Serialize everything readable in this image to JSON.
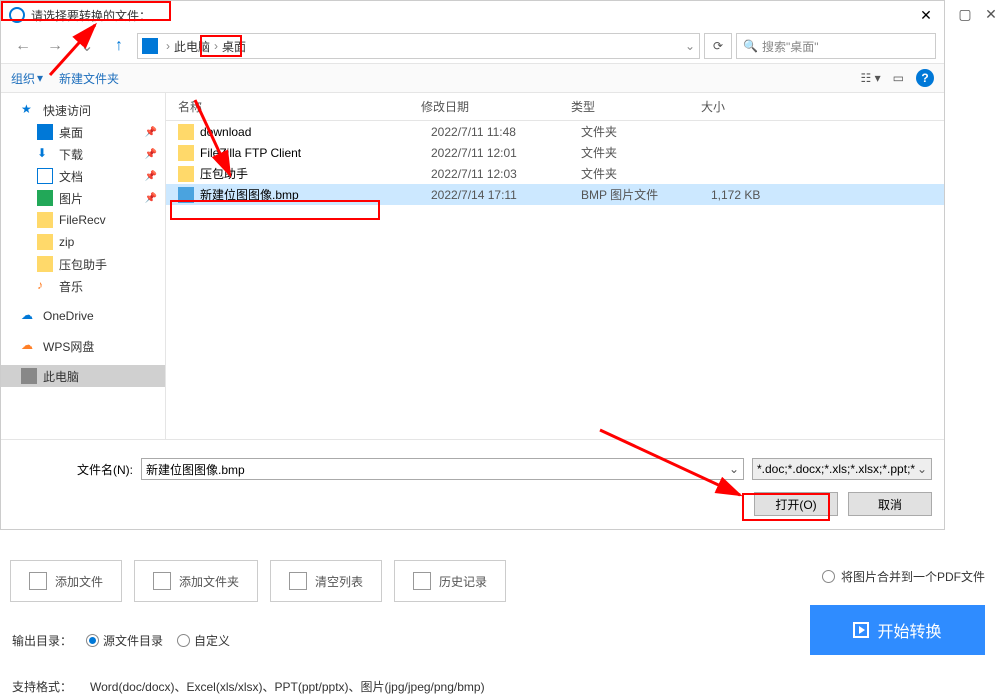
{
  "titlebar": {
    "title": "请选择要转换的文件："
  },
  "breadcrumb": {
    "pc": "此电脑",
    "desktop": "桌面"
  },
  "search": {
    "placeholder": "搜索\"桌面\""
  },
  "toolbar": {
    "organize": "组织",
    "newfolder": "新建文件夹"
  },
  "sidebar": {
    "quickaccess": "快速访问",
    "desktop": "桌面",
    "downloads": "下载",
    "documents": "文档",
    "pictures": "图片",
    "filerecv": "FileRecv",
    "zip": "zip",
    "yabao": "压包助手",
    "music": "音乐",
    "onedrive": "OneDrive",
    "wps": "WPS网盘",
    "thispc": "此电脑"
  },
  "columns": {
    "name": "名称",
    "date": "修改日期",
    "type": "类型",
    "size": "大小"
  },
  "files": [
    {
      "name": "download",
      "date": "2022/7/11 11:48",
      "type": "文件夹",
      "size": ""
    },
    {
      "name": "FileZilla FTP Client",
      "date": "2022/7/11 12:01",
      "type": "文件夹",
      "size": ""
    },
    {
      "name": "压包助手",
      "date": "2022/7/11 12:03",
      "type": "文件夹",
      "size": ""
    },
    {
      "name": "新建位图图像.bmp",
      "date": "2022/7/14 17:11",
      "type": "BMP 图片文件",
      "size": "1,172 KB"
    }
  ],
  "filename": {
    "label": "文件名(N):",
    "value": "新建位图图像.bmp"
  },
  "filetype": {
    "label": "*.doc;*.docx;*.xls;*.xlsx;*.ppt;*"
  },
  "buttons": {
    "open": "打开(O)",
    "cancel": "取消"
  },
  "lower": {
    "addfile": "添加文件",
    "addfolder": "添加文件夹",
    "clear": "清空列表",
    "history": "历史记录",
    "merge": "将图片合并到一个PDF文件"
  },
  "output": {
    "label": "输出目录：",
    "opt1": "源文件目录",
    "opt2": "自定义"
  },
  "start": "开始转换",
  "support": {
    "label": "支持格式：",
    "formats": "Word(doc/docx)、Excel(xls/xlsx)、PPT(ppt/pptx)、图片(jpg/jpeg/png/bmp)"
  }
}
